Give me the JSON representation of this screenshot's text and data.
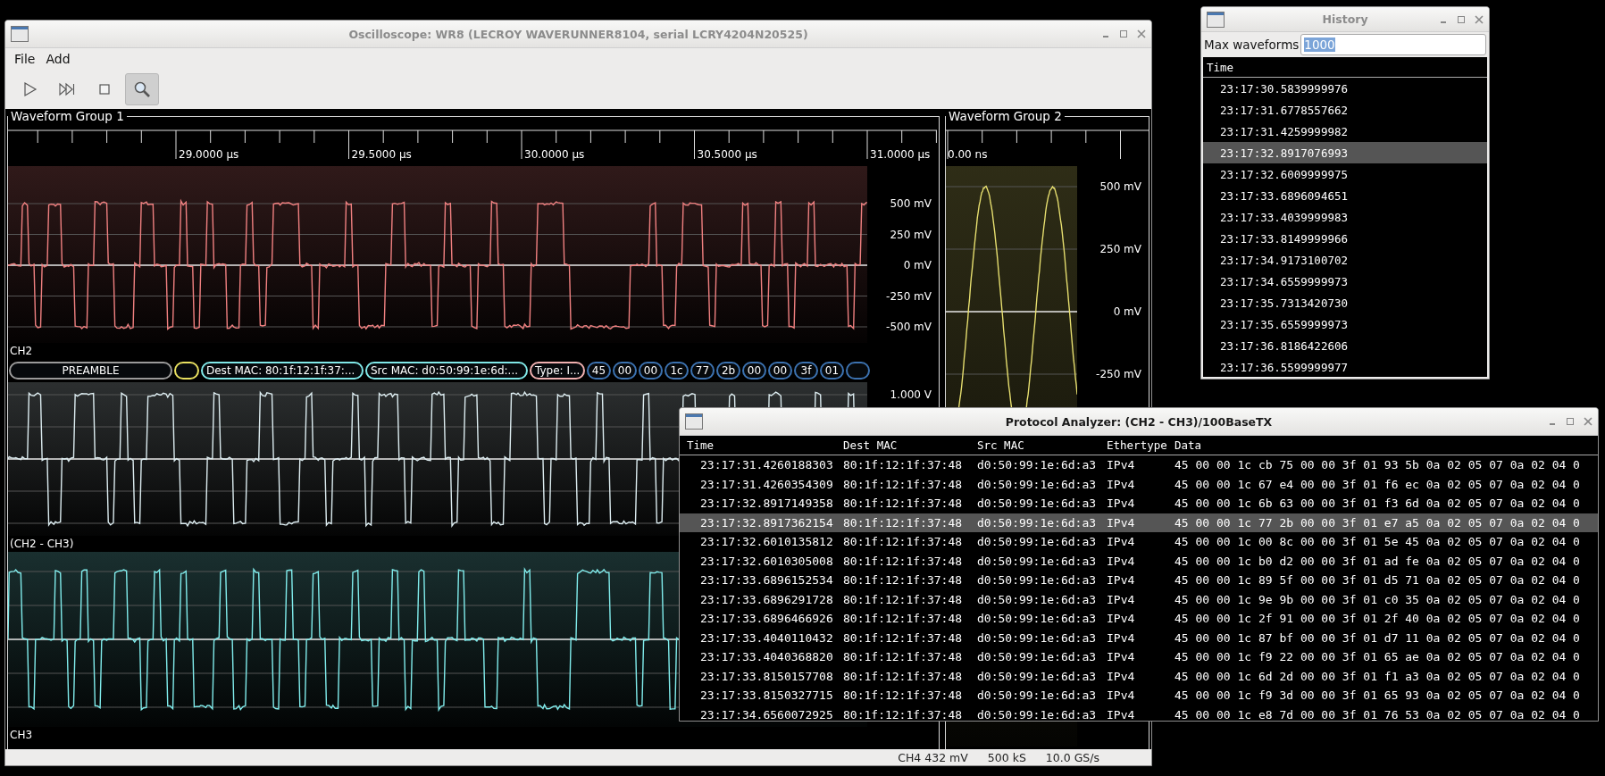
{
  "main_window": {
    "title": "Oscilloscope: WR8 (LECROY WAVERUNNER8104, serial LCRY4204N20525)",
    "menu": [
      "File",
      "Add"
    ],
    "toolbar_buttons": [
      {
        "selected": false
      },
      {
        "selected": false
      },
      {
        "selected": false
      },
      {
        "selected": true
      }
    ],
    "waveform_groups": [
      {
        "title": "Waveform Group 1",
        "time_labels": [
          "29.0000 µs",
          "29.5000 µs",
          "30.0000 µs",
          "30.5000 µs",
          "31.0000 µs"
        ],
        "panes": [
          {
            "kind": "digital",
            "channel": "CH2",
            "color": "#f08080",
            "axis_labels": [
              "500 mV",
              "250 mV",
              "0 mV",
              "-250 mV",
              "-500 mV"
            ],
            "protocol_decode": [
              {
                "kind": "preamble",
                "text": "PREAMBLE",
                "color": "#9a9a9a"
              },
              {
                "kind": "sfd",
                "color": "#e8e060"
              },
              {
                "kind": "mac",
                "text": "Dest MAC: 80:1f:12:1f:37:...",
                "color": "#80e8e8"
              },
              {
                "kind": "mac",
                "text": "Src MAC: d0:50:99:1e:6d:...",
                "color": "#80e8e8"
              },
              {
                "kind": "type",
                "text": "Type: I...",
                "color": "#f0b0b0"
              },
              {
                "kind": "byte",
                "text": "45",
                "color": "#3c72b0"
              },
              {
                "kind": "byte",
                "text": "00",
                "color": "#3c72b0"
              },
              {
                "kind": "byte",
                "text": "00",
                "color": "#3c72b0"
              },
              {
                "kind": "byte",
                "text": "1c",
                "color": "#3c72b0"
              },
              {
                "kind": "byte",
                "text": "77",
                "color": "#3c72b0"
              },
              {
                "kind": "byte",
                "text": "2b",
                "color": "#3c72b0"
              },
              {
                "kind": "byte",
                "text": "00",
                "color": "#3c72b0"
              },
              {
                "kind": "byte",
                "text": "00",
                "color": "#3c72b0"
              },
              {
                "kind": "byte",
                "text": "3f",
                "color": "#3c72b0"
              },
              {
                "kind": "byte",
                "text": "01",
                "color": "#3c72b0"
              },
              {
                "kind": "byte",
                "color": "#3c72b0"
              }
            ]
          },
          {
            "kind": "digital",
            "channel": "(CH2 - CH3)",
            "color": "#dcecf0",
            "axis_labels": [
              "1.000 V"
            ]
          },
          {
            "kind": "digital",
            "channel": "CH3",
            "color": "#80ecec"
          }
        ]
      },
      {
        "title": "Waveform Group 2",
        "time_labels": [
          "0.00 ns"
        ],
        "panes": [
          {
            "kind": "sine",
            "color": "#e8e070",
            "axis_labels": [
              "500 mV",
              "250 mV",
              "0 mV",
              "-250 mV"
            ]
          }
        ]
      }
    ],
    "status_bar": [
      "CH4 432 mV",
      "500 kS",
      "10.0 GS/s"
    ]
  },
  "history": {
    "title": "History",
    "max_label": "Max waveforms",
    "max_value": "1000",
    "column": "Time",
    "rows": [
      {
        "time": "23:17:30.5839999976",
        "selected": false
      },
      {
        "time": "23:17:31.6778557662",
        "selected": false
      },
      {
        "time": "23:17:31.4259999982",
        "selected": false
      },
      {
        "time": "23:17:32.8917076993",
        "selected": true
      },
      {
        "time": "23:17:32.6009999975",
        "selected": false
      },
      {
        "time": "23:17:33.6896094651",
        "selected": false
      },
      {
        "time": "23:17:33.4039999983",
        "selected": false
      },
      {
        "time": "23:17:33.8149999966",
        "selected": false
      },
      {
        "time": "23:17:34.9173100702",
        "selected": false
      },
      {
        "time": "23:17:34.6559999973",
        "selected": false
      },
      {
        "time": "23:17:35.7313420730",
        "selected": false
      },
      {
        "time": "23:17:35.6559999973",
        "selected": false
      },
      {
        "time": "23:17:36.8186422606",
        "selected": false
      },
      {
        "time": "23:17:36.5599999977",
        "selected": false
      }
    ]
  },
  "protocol": {
    "title": "Protocol Analyzer: (CH2 - CH3)/100BaseTX",
    "columns": [
      "Time",
      "Dest MAC",
      "Src MAC",
      "Ethertype",
      "Data"
    ],
    "rows": [
      {
        "time": "23:17:31.4260188303",
        "dest": "80:1f:12:1f:37:48",
        "src": "d0:50:99:1e:6d:a3",
        "ethertype": "IPv4",
        "data": "45 00 00 1c cb 75 00 00 3f 01 93 5b 0a 02 05 07 0a 02 04 0",
        "selected": false
      },
      {
        "time": "23:17:31.4260354309",
        "dest": "80:1f:12:1f:37:48",
        "src": "d0:50:99:1e:6d:a3",
        "ethertype": "IPv4",
        "data": "45 00 00 1c 67 e4 00 00 3f 01 f6 ec 0a 02 05 07 0a 02 04 0",
        "selected": false
      },
      {
        "time": "23:17:32.8917149358",
        "dest": "80:1f:12:1f:37:48",
        "src": "d0:50:99:1e:6d:a3",
        "ethertype": "IPv4",
        "data": "45 00 00 1c 6b 63 00 00 3f 01 f3 6d 0a 02 05 07 0a 02 04 0",
        "selected": false
      },
      {
        "time": "23:17:32.8917362154",
        "dest": "80:1f:12:1f:37:48",
        "src": "d0:50:99:1e:6d:a3",
        "ethertype": "IPv4",
        "data": "45 00 00 1c 77 2b 00 00 3f 01 e7 a5 0a 02 05 07 0a 02 04 0",
        "selected": true
      },
      {
        "time": "23:17:32.6010135812",
        "dest": "80:1f:12:1f:37:48",
        "src": "d0:50:99:1e:6d:a3",
        "ethertype": "IPv4",
        "data": "45 00 00 1c 00 8c 00 00 3f 01 5e 45 0a 02 05 07 0a 02 04 0",
        "selected": false
      },
      {
        "time": "23:17:32.6010305008",
        "dest": "80:1f:12:1f:37:48",
        "src": "d0:50:99:1e:6d:a3",
        "ethertype": "IPv4",
        "data": "45 00 00 1c b0 d2 00 00 3f 01 ad fe 0a 02 05 07 0a 02 04 0",
        "selected": false
      },
      {
        "time": "23:17:33.6896152534",
        "dest": "80:1f:12:1f:37:48",
        "src": "d0:50:99:1e:6d:a3",
        "ethertype": "IPv4",
        "data": "45 00 00 1c 89 5f 00 00 3f 01 d5 71 0a 02 05 07 0a 02 04 0",
        "selected": false
      },
      {
        "time": "23:17:33.6896291728",
        "dest": "80:1f:12:1f:37:48",
        "src": "d0:50:99:1e:6d:a3",
        "ethertype": "IPv4",
        "data": "45 00 00 1c 9e 9b 00 00 3f 01 c0 35 0a 02 05 07 0a 02 04 0",
        "selected": false
      },
      {
        "time": "23:17:33.6896466926",
        "dest": "80:1f:12:1f:37:48",
        "src": "d0:50:99:1e:6d:a3",
        "ethertype": "IPv4",
        "data": "45 00 00 1c 2f 91 00 00 3f 01 2f 40 0a 02 05 07 0a 02 04 0",
        "selected": false
      },
      {
        "time": "23:17:33.4040110432",
        "dest": "80:1f:12:1f:37:48",
        "src": "d0:50:99:1e:6d:a3",
        "ethertype": "IPv4",
        "data": "45 00 00 1c 87 bf 00 00 3f 01 d7 11 0a 02 05 07 0a 02 04 0",
        "selected": false
      },
      {
        "time": "23:17:33.4040368820",
        "dest": "80:1f:12:1f:37:48",
        "src": "d0:50:99:1e:6d:a3",
        "ethertype": "IPv4",
        "data": "45 00 00 1c f9 22 00 00 3f 01 65 ae 0a 02 05 07 0a 02 04 0",
        "selected": false
      },
      {
        "time": "23:17:33.8150157708",
        "dest": "80:1f:12:1f:37:48",
        "src": "d0:50:99:1e:6d:a3",
        "ethertype": "IPv4",
        "data": "45 00 00 1c 6d 2d 00 00 3f 01 f1 a3 0a 02 05 07 0a 02 04 0",
        "selected": false
      },
      {
        "time": "23:17:33.8150327715",
        "dest": "80:1f:12:1f:37:48",
        "src": "d0:50:99:1e:6d:a3",
        "ethertype": "IPv4",
        "data": "45 00 00 1c f9 3d 00 00 3f 01 65 93 0a 02 05 07 0a 02 04 0",
        "selected": false
      },
      {
        "time": "23:17:34.6560072925",
        "dest": "80:1f:12:1f:37:48",
        "src": "d0:50:99:1e:6d:a3",
        "ethertype": "IPv4",
        "data": "45 00 00 1c e8 7d 00 00 3f 01 76 53 0a 02 05 07 0a 02 04 0",
        "selected": false
      }
    ]
  }
}
